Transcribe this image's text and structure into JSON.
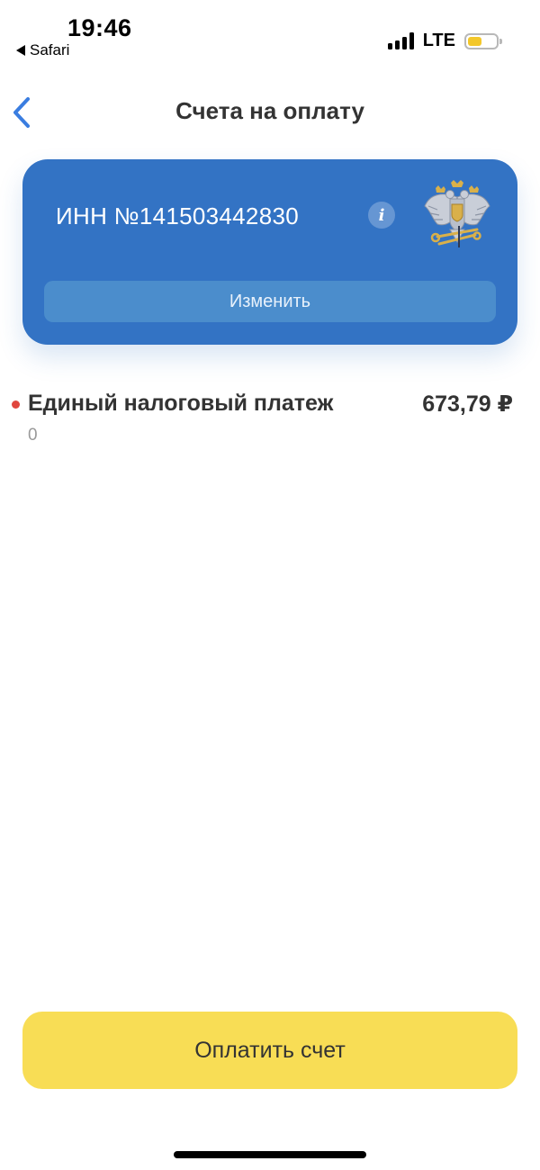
{
  "status_bar": {
    "time": "19:46",
    "back_app": "Safari",
    "network": "LTE",
    "battery_level": 0.55
  },
  "header": {
    "title": "Счета на оплату"
  },
  "tax_card": {
    "inn": "ИНН №141503442830",
    "info_icon_glyph": "i",
    "change_label": "Изменить",
    "background_color": "#3373c4"
  },
  "bills": [
    {
      "name": "Единый налоговый платеж",
      "amount": "673,79 ₽",
      "subtitle": "0",
      "status_color": "#e0463e"
    }
  ],
  "pay_button": {
    "label": "Оплатить счет",
    "color": "#f8dd55"
  },
  "icons": {
    "back": "chevron-left-icon",
    "info": "info-icon",
    "emblem": "coat-of-arms-icon",
    "signal": "cellular-signal-icon",
    "battery": "battery-icon"
  }
}
